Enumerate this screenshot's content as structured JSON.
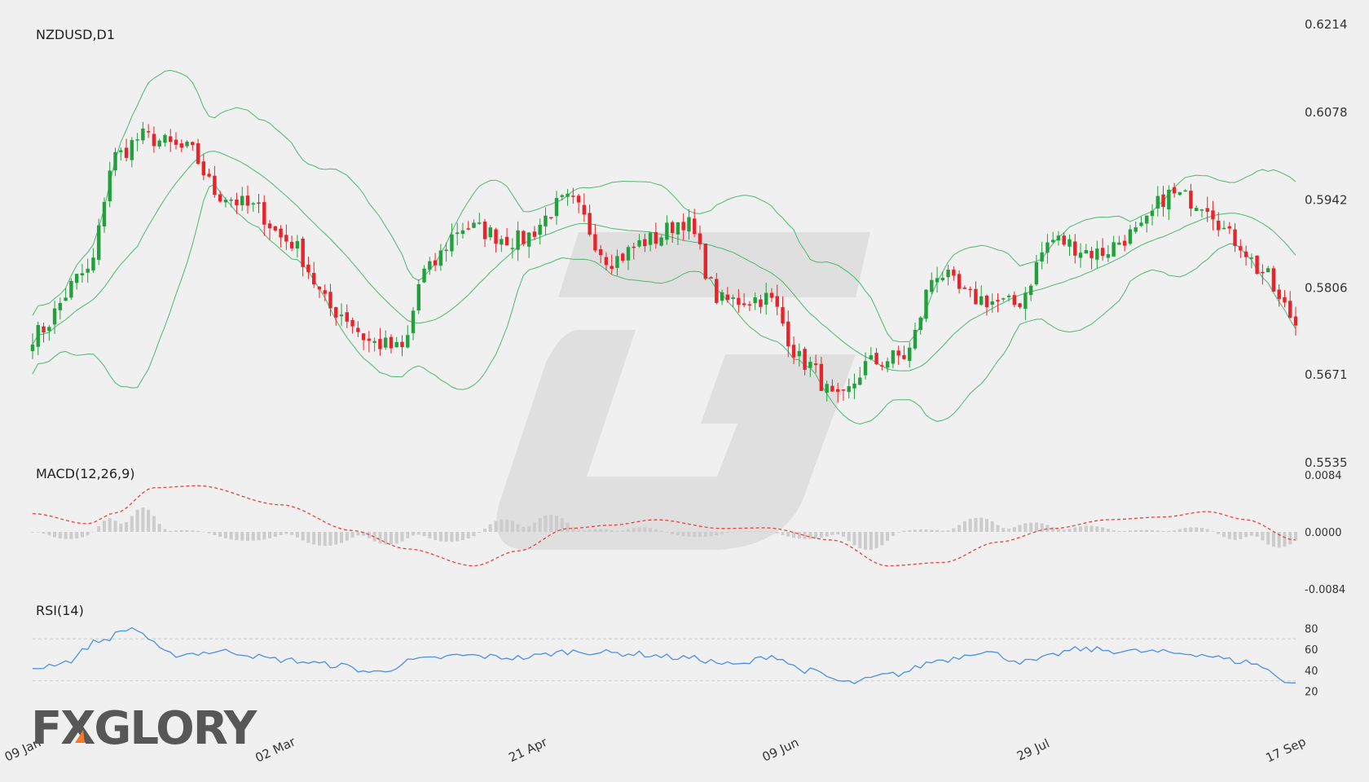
{
  "brand": {
    "logo_text": "FXGLORY"
  },
  "chart_data": [
    {
      "type": "candlestick",
      "title": "NZDUSD,D1",
      "y_ticks": [
        "0.6214",
        "0.6078",
        "0.5942",
        "0.5806",
        "0.5671",
        "0.5535"
      ],
      "ylim": [
        0.5535,
        0.6214
      ],
      "x_tick_labels": [
        "09 Jan",
        "02 Mar",
        "21 Apr",
        "09 Jun",
        "29 Jul",
        "17 Sep"
      ],
      "overlays": [
        "Bollinger Bands (upper, middle, lower)"
      ],
      "colors": {
        "up": "#22a03c",
        "down": "#e8232a",
        "bands": "#4cb870"
      },
      "close_anchors": [
        [
          0,
          0.5733
        ],
        [
          10,
          0.583
        ],
        [
          15,
          0.601
        ],
        [
          20,
          0.604
        ],
        [
          28,
          0.602
        ],
        [
          34,
          0.595
        ],
        [
          40,
          0.593
        ],
        [
          46,
          0.588
        ],
        [
          55,
          0.577
        ],
        [
          62,
          0.572
        ],
        [
          67,
          0.571
        ],
        [
          71,
          0.583
        ],
        [
          78,
          0.59
        ],
        [
          88,
          0.588
        ],
        [
          97,
          0.594
        ],
        [
          105,
          0.585
        ],
        [
          112,
          0.588
        ],
        [
          118,
          0.591
        ],
        [
          125,
          0.5785
        ],
        [
          133,
          0.579
        ],
        [
          140,
          0.569
        ],
        [
          146,
          0.563
        ],
        [
          152,
          0.569
        ],
        [
          158,
          0.57
        ],
        [
          164,
          0.583
        ],
        [
          170,
          0.579
        ],
        [
          178,
          0.578
        ],
        [
          185,
          0.588
        ],
        [
          193,
          0.586
        ],
        [
          200,
          0.589
        ],
        [
          206,
          0.595
        ],
        [
          212,
          0.594
        ],
        [
          218,
          0.588
        ],
        [
          223,
          0.583
        ],
        [
          227,
          0.5775
        ],
        [
          229,
          0.575
        ]
      ]
    },
    {
      "type": "line+histogram",
      "title": "MACD(12,26,9)",
      "y_ticks": [
        "0.0084",
        "0.0000",
        "-0.0084"
      ],
      "ylim": [
        -0.0084,
        0.0084
      ],
      "colors": {
        "signal": "#e8423d",
        "histogram": "#cccccc"
      },
      "signal_anchors": [
        [
          0,
          0.0027
        ],
        [
          10,
          0.0012
        ],
        [
          15,
          0.0028
        ],
        [
          22,
          0.0065
        ],
        [
          30,
          0.0068
        ],
        [
          45,
          0.004
        ],
        [
          58,
          0.0002
        ],
        [
          68,
          -0.0025
        ],
        [
          80,
          -0.005
        ],
        [
          88,
          -0.0028
        ],
        [
          97,
          0.0005
        ],
        [
          105,
          0.001
        ],
        [
          113,
          0.0018
        ],
        [
          125,
          0.0005
        ],
        [
          133,
          0.0006
        ],
        [
          145,
          -0.0012
        ],
        [
          155,
          -0.005
        ],
        [
          165,
          -0.0045
        ],
        [
          175,
          -0.0015
        ],
        [
          185,
          0.0005
        ],
        [
          195,
          0.0018
        ],
        [
          205,
          0.0022
        ],
        [
          213,
          0.003
        ],
        [
          220,
          0.0018
        ],
        [
          229,
          -0.0012
        ]
      ]
    },
    {
      "type": "line",
      "title": "RSI(14)",
      "y_ticks": [
        "80",
        "60",
        "40",
        "20"
      ],
      "ylim": [
        15,
        85
      ],
      "levels": [
        70,
        30
      ],
      "colors": {
        "line": "#4a8fe8",
        "levels": "#cccccc"
      },
      "rsi_anchors": [
        [
          0,
          42
        ],
        [
          6,
          48
        ],
        [
          12,
          68
        ],
        [
          18,
          80
        ],
        [
          25,
          55
        ],
        [
          35,
          58
        ],
        [
          45,
          50
        ],
        [
          55,
          45
        ],
        [
          62,
          38
        ],
        [
          70,
          50
        ],
        [
          78,
          54
        ],
        [
          88,
          52
        ],
        [
          98,
          58
        ],
        [
          108,
          56
        ],
        [
          118,
          52
        ],
        [
          128,
          45
        ],
        [
          134,
          54
        ],
        [
          140,
          40
        ],
        [
          148,
          28
        ],
        [
          156,
          36
        ],
        [
          165,
          50
        ],
        [
          172,
          58
        ],
        [
          180,
          48
        ],
        [
          190,
          60
        ],
        [
          200,
          58
        ],
        [
          210,
          56
        ],
        [
          220,
          48
        ],
        [
          229,
          28
        ]
      ]
    }
  ]
}
